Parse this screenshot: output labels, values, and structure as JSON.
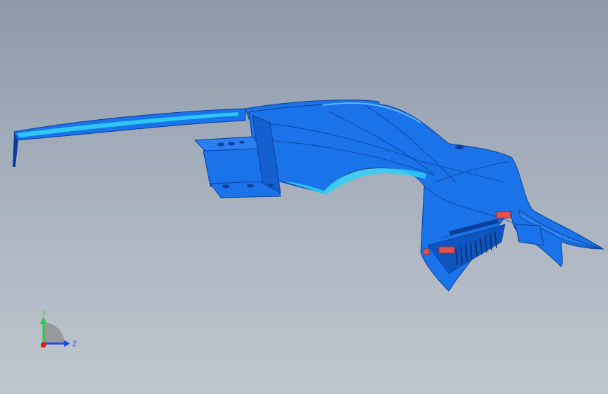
{
  "viewport": {
    "background_top": "#8d99aa",
    "background_bottom": "#bfc6cf",
    "part_color": "#1a73e8",
    "part_dark": "#0b3f9c",
    "part_highlight": "#2fd0f5",
    "marker_color": "#e0524e"
  },
  "triad": {
    "y_label": "Y",
    "z_label": "Z",
    "y_color": "#2ecc40",
    "z_color": "#1f4fd8",
    "x_color": "#e02020"
  }
}
